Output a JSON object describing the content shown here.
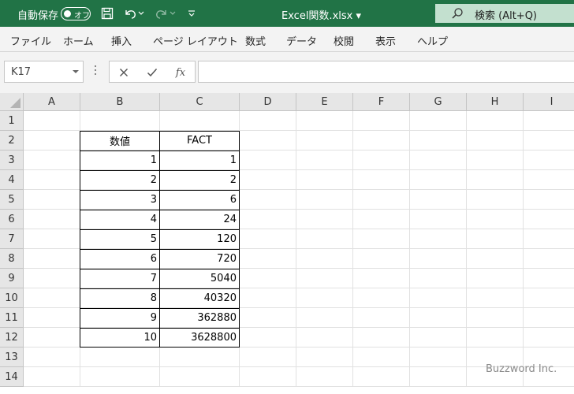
{
  "titlebar": {
    "autosave_label": "自動保存",
    "autosave_state": "オフ",
    "file_name": "Excel関数.xlsx ▾",
    "search_text": "検索 (Alt+Q)",
    "accent_color": "#217346"
  },
  "ribbon": {
    "tabs": [
      "ファイル",
      "ホーム",
      "挿入",
      "ページ レイアウト",
      "数式",
      "データ",
      "校閲",
      "表示",
      "ヘルプ"
    ]
  },
  "formula_bar": {
    "name_box": "K17",
    "fx_label": "fx",
    "formula": ""
  },
  "sheet": {
    "columns": [
      "A",
      "B",
      "C",
      "D",
      "E",
      "F",
      "G",
      "H",
      "I"
    ],
    "rows": [
      "1",
      "2",
      "3",
      "4",
      "5",
      "6",
      "7",
      "8",
      "9",
      "10",
      "11",
      "12",
      "13",
      "14"
    ],
    "table_header": [
      "数値",
      "FACT"
    ],
    "table_rows": [
      [
        "1",
        "1"
      ],
      [
        "2",
        "2"
      ],
      [
        "3",
        "6"
      ],
      [
        "4",
        "24"
      ],
      [
        "5",
        "120"
      ],
      [
        "6",
        "720"
      ],
      [
        "7",
        "5040"
      ],
      [
        "8",
        "40320"
      ],
      [
        "9",
        "362880"
      ],
      [
        "10",
        "3628800"
      ]
    ]
  },
  "watermark": "Buzzword Inc."
}
